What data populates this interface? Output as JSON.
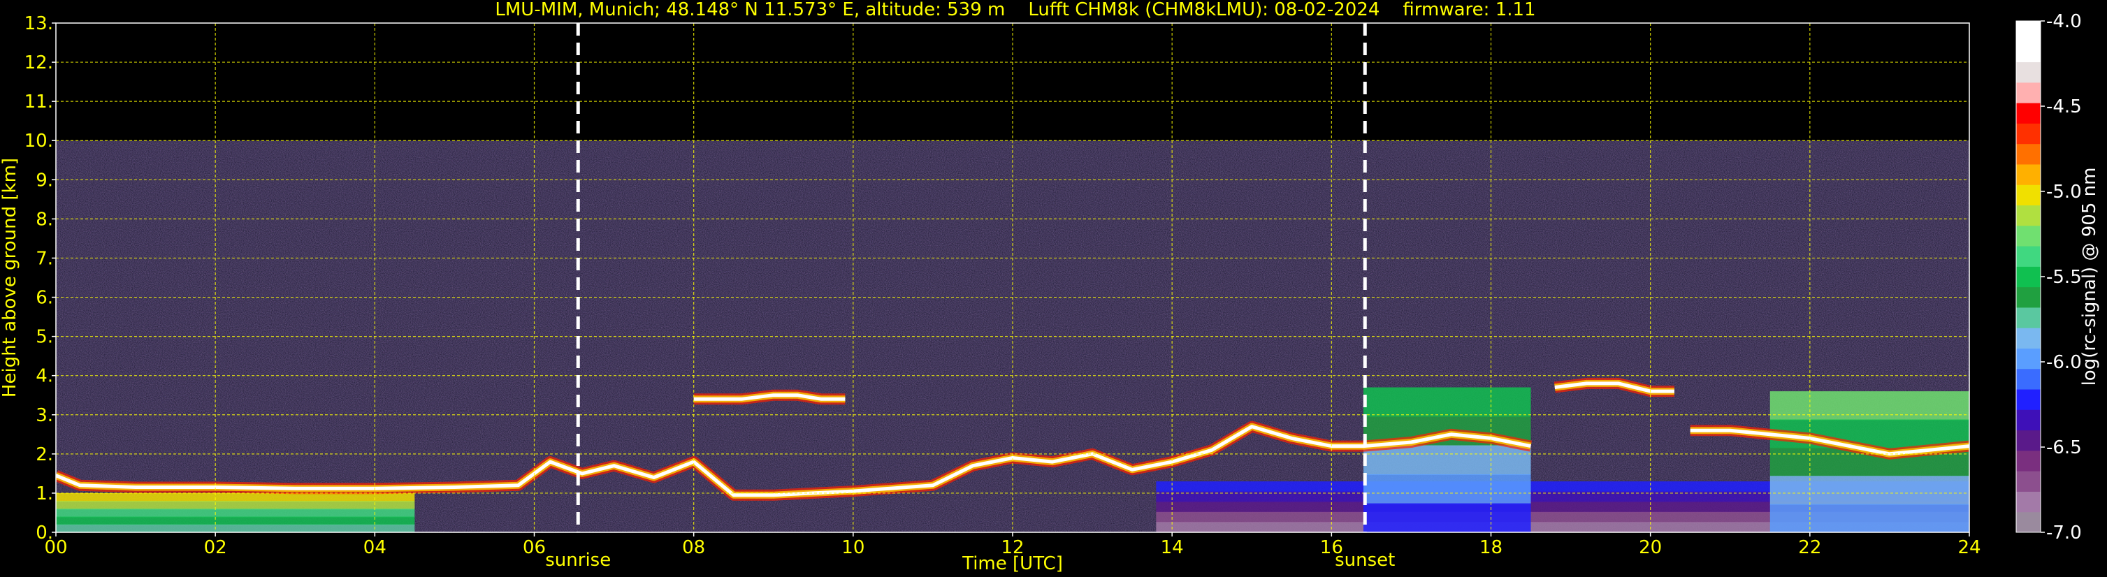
{
  "chart_data": {
    "type": "heatmap",
    "title": "LMU-MIM, Munich; 48.148° N 11.573° E, altitude: 539 m    Lufft CHM8k (CHM8kLMU): 08-02-2024    firmware: 1.11",
    "xlabel": "Time [UTC]",
    "ylabel": "Height above ground [km]",
    "xlim": [
      0,
      24
    ],
    "ylim": [
      0,
      13
    ],
    "x_ticks": [
      "00",
      "02",
      "04",
      "06",
      "08",
      "10",
      "12",
      "14",
      "16",
      "18",
      "20",
      "22",
      "24"
    ],
    "x_tick_values": [
      0,
      2,
      4,
      6,
      8,
      10,
      12,
      14,
      16,
      18,
      20,
      22,
      24
    ],
    "y_ticks": [
      "0.",
      "1.",
      "2.",
      "3.",
      "4.",
      "5.",
      "6.",
      "7.",
      "8.",
      "9.",
      "10.",
      "11.",
      "12.",
      "13."
    ],
    "y_tick_values": [
      0,
      1,
      2,
      3,
      4,
      5,
      6,
      7,
      8,
      9,
      10,
      11,
      12,
      13
    ],
    "grid": true,
    "grid_color": "#ffff00",
    "annotations": [
      {
        "label": "sunrise",
        "x": 6.55
      },
      {
        "label": "sunset",
        "x": 16.42
      }
    ],
    "colorbar": {
      "label": "log(rc-signal) @ 905 nm",
      "min": -7.0,
      "max": -4.0,
      "ticks": [
        "-4.0",
        "-4.5",
        "-5.0",
        "-5.5",
        "-6.0",
        "-6.5",
        "-7.0"
      ],
      "tick_values": [
        -4.0,
        -4.5,
        -5.0,
        -5.5,
        -6.0,
        -6.5,
        -7.0
      ],
      "colors": [
        "#9a8a9e",
        "#a37aa8",
        "#8c4f8e",
        "#7a2f7f",
        "#5a1a8a",
        "#3e10b8",
        "#2020ff",
        "#3a6cff",
        "#5a9eff",
        "#7ab8f0",
        "#5ac8a0",
        "#20a040",
        "#10c050",
        "#40d880",
        "#70e070",
        "#b0e040",
        "#f0e000",
        "#ffb000",
        "#ff7000",
        "#ff3000",
        "#ff0000",
        "#ffb0b0",
        "#e8e0e0",
        "#ffffff",
        "#ffffff"
      ]
    },
    "max_range_km": 10.0,
    "cloud_base_layers": [
      {
        "name": "boundary-layer-top",
        "points": [
          [
            0,
            1.45
          ],
          [
            0.3,
            1.2
          ],
          [
            1,
            1.15
          ],
          [
            2,
            1.15
          ],
          [
            3,
            1.12
          ],
          [
            4,
            1.12
          ],
          [
            5,
            1.15
          ],
          [
            5.8,
            1.2
          ],
          [
            6.2,
            1.8
          ],
          [
            6.6,
            1.5
          ],
          [
            7,
            1.7
          ],
          [
            7.5,
            1.4
          ],
          [
            8,
            1.8
          ],
          [
            8.5,
            0.95
          ],
          [
            9,
            0.95
          ],
          [
            10,
            1.05
          ],
          [
            11,
            1.2
          ],
          [
            11.5,
            1.7
          ],
          [
            12,
            1.9
          ],
          [
            12.5,
            1.8
          ],
          [
            13,
            2.0
          ],
          [
            13.5,
            1.6
          ],
          [
            14,
            1.8
          ],
          [
            14.5,
            2.1
          ],
          [
            15,
            2.7
          ],
          [
            15.5,
            2.4
          ],
          [
            16,
            2.2
          ],
          [
            16.4,
            2.2
          ],
          [
            17,
            2.3
          ],
          [
            17.5,
            2.5
          ],
          [
            18,
            2.4
          ],
          [
            18.5,
            2.2
          ]
        ]
      },
      {
        "name": "upper-cloud-layer",
        "points": [
          [
            18.8,
            3.7
          ],
          [
            19.2,
            3.8
          ],
          [
            19.6,
            3.8
          ],
          [
            20,
            3.6
          ],
          [
            20.3,
            3.6
          ]
        ]
      },
      {
        "name": "mid-cloud-segment",
        "points": [
          [
            20.5,
            2.6
          ],
          [
            21,
            2.6
          ],
          [
            21.5,
            2.5
          ],
          [
            22,
            2.4
          ],
          [
            22.5,
            2.2
          ],
          [
            23,
            2.0
          ],
          [
            23.5,
            2.1
          ],
          [
            24,
            2.2
          ]
        ]
      },
      {
        "name": "small-cloud-segment",
        "points": [
          [
            9.9,
            3.4
          ],
          [
            9.6,
            3.4
          ],
          [
            9.3,
            3.5
          ],
          [
            9.0,
            3.5
          ],
          [
            8.6,
            3.4
          ],
          [
            8.0,
            3.4
          ]
        ]
      }
    ],
    "signal_regions": [
      {
        "name": "morning-aerosol",
        "x": [
          0,
          4.5
        ],
        "top_km": 1.0,
        "level": -5.3
      },
      {
        "name": "afternoon-aerosol",
        "x": [
          13.8,
          24
        ],
        "top_km": 1.3,
        "level": -6.5
      },
      {
        "name": "evening-convection",
        "x": [
          21.5,
          24
        ],
        "top_km": 3.6,
        "level": -5.6
      },
      {
        "name": "afternoon-convection",
        "x": [
          16.4,
          18.5
        ],
        "top_km": 3.7,
        "level": -5.8
      }
    ]
  }
}
